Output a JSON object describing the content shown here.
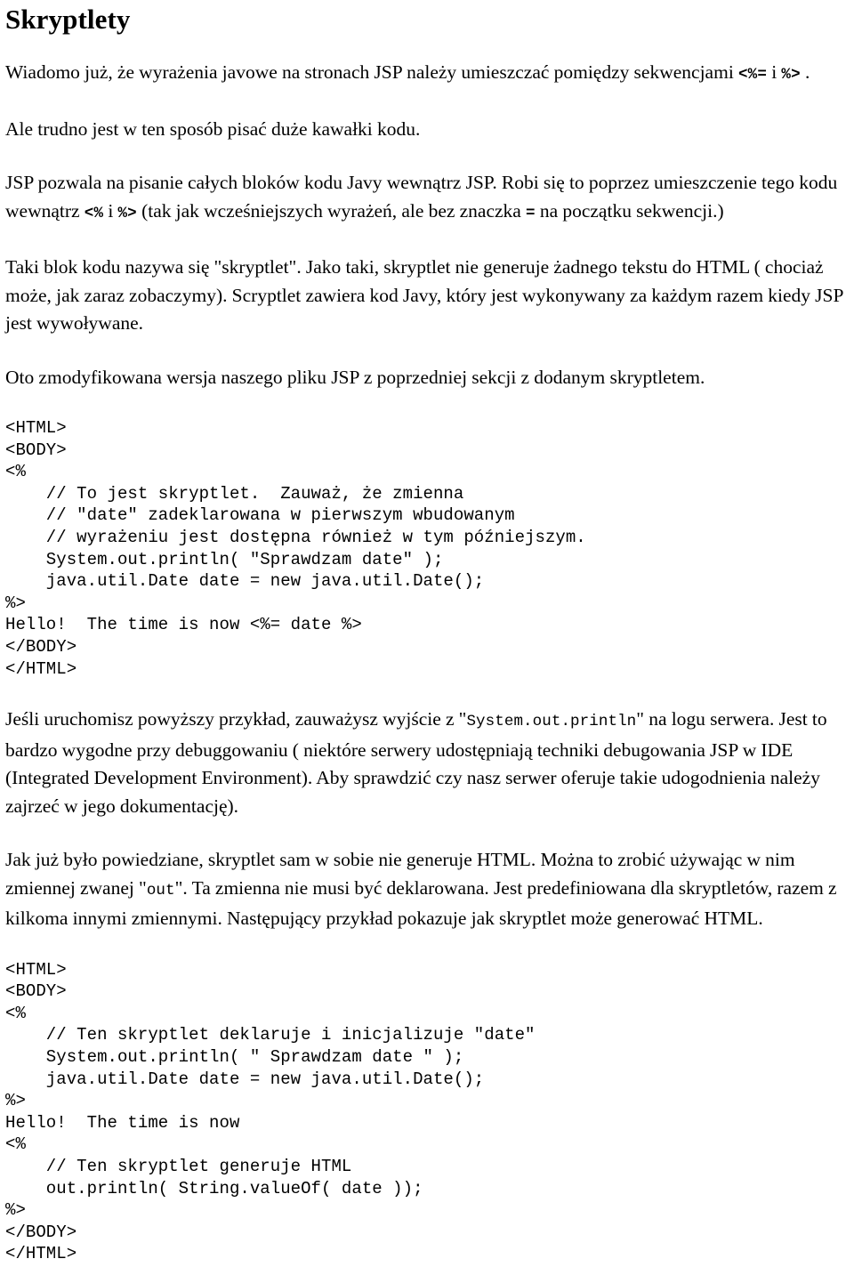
{
  "document": {
    "title": "Skryptlety",
    "language": "pl"
  },
  "paragraphs": {
    "p1_a": "Wiadomo już, że wyrażenia javowe na stronach JSP należy umieszczać pomiędzy sekwencjami ",
    "p1_code1": "<%=",
    "p1_mid": " i ",
    "p1_code2": "%>",
    "p1_b": " .",
    "p2": "Ale trudno jest w ten sposób pisać duże kawałki kodu.",
    "p3_a": "JSP pozwala na pisanie całych bloków kodu Javy wewnątrz JSP. Robi się to poprzez umieszczenie tego kodu wewnątrz ",
    "p3_code1": "<%",
    "p3_mid": " i ",
    "p3_code2": "%>",
    "p3_b": " (tak jak wcześniejszych wyrażeń, ale bez znaczka ",
    "p3_code3": "=",
    "p3_c": " na początku sekwencji.)",
    "p4": "Taki blok kodu nazywa się \"skryptlet\".  Jako taki, skryptlet nie generuje żadnego tekstu do HTML ( chociaż może, jak zaraz zobaczymy).  Scryptlet zawiera kod Javy, który jest wykonywany za każdym razem kiedy JSP jest wywoływane.",
    "p5": "Oto zmodyfikowana wersja naszego pliku JSP z poprzedniej sekcji z dodanym skryptletem.",
    "p6_a": "Jeśli uruchomisz powyższy przykład, zauważysz wyjście z \"",
    "p6_code1": "System.out.println",
    "p6_b": "\" na logu serwera.  Jest to bardzo wygodne przy debuggowaniu ( niektóre serwery udostępniają techniki debugowania JSP w IDE (Integrated Development Environment). Aby sprawdzić czy nasz serwer oferuje takie udogodnienia należy zajrzeć w jego dokumentację).",
    "p7_a": "Jak już było powiedziane, skryptlet sam w sobie nie generuje HTML.  Można to zrobić używając w nim zmiennej zwanej \"",
    "p7_code1": "out",
    "p7_b": "\".  Ta zmienna nie musi być deklarowana.  Jest predefiniowana dla skryptletów, razem z kilkoma innymi zmiennymi.  Następujący przykład pokazuje jak skryptlet może generować HTML."
  },
  "code_blocks": {
    "first_example": "<HTML>\n<BODY>\n<%\n    // To jest skryptlet.  Zauważ, że zmienna\n    // \"date\" zadeklarowana w pierwszym wbudowanym\n    // wyrażeniu jest dostępna również w tym późniejszym.\n    System.out.println( \"Sprawdzam date\" );\n    java.util.Date date = new java.util.Date();\n%>\nHello!  The time is now <%= date %>\n</BODY>\n</HTML>",
    "second_example": "<HTML>\n<BODY>\n<%\n    // Ten skryptlet deklaruje i inicjalizuje \"date\"\n    System.out.println( \" Sprawdzam date \" );\n    java.util.Date date = new java.util.Date();\n%>\nHello!  The time is now\n<%\n    // Ten skryptlet generuje HTML\n    out.println( String.valueOf( date ));\n%>\n</BODY>\n</HTML>"
  },
  "colors": {
    "text": "#000000",
    "background": "#ffffff"
  }
}
